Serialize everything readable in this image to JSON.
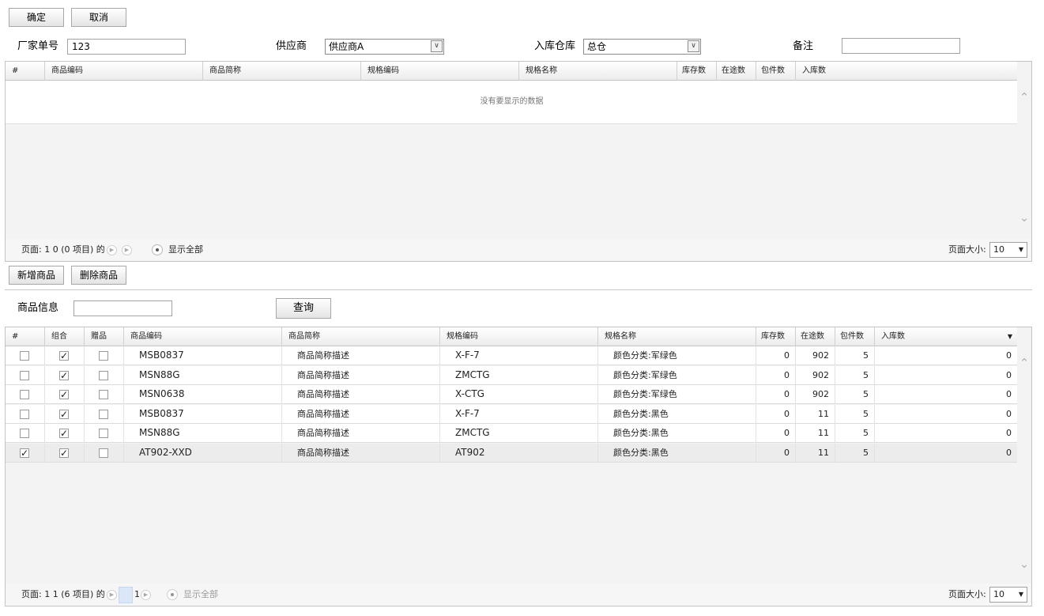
{
  "toolbar": {
    "confirm": "确定",
    "cancel": "取消"
  },
  "form": {
    "vendor_no_label": "厂家单号",
    "vendor_no_value": "123",
    "supplier_label": "供应商",
    "supplier_value": "供应商A",
    "warehouse_label": "入库仓库",
    "warehouse_value": "总仓",
    "remark_label": "备注",
    "remark_value": ""
  },
  "grid1": {
    "headers": [
      "#",
      "商品编码",
      "商品简称",
      "规格编码",
      "规格名称",
      "库存数",
      "在途数",
      "包件数",
      "入库数"
    ],
    "empty_text": "没有要显示的数据",
    "pager_text": "页面: 1 0 (0 项目) 的",
    "show_all": "显示全部",
    "page_size_label": "页面大小:",
    "page_size": "10"
  },
  "actions": {
    "add": "新增商品",
    "delete": "删除商品"
  },
  "search": {
    "label": "商品信息",
    "value": "",
    "button": "查询"
  },
  "grid2": {
    "headers": [
      "#",
      "组合",
      "赠品",
      "商品编码",
      "商品简称",
      "规格编码",
      "规格名称",
      "库存数",
      "在途数",
      "包件数",
      "入库数"
    ],
    "rows": [
      {
        "sel": false,
        "combo": true,
        "gift": false,
        "code": "MSB0837",
        "name": "商品简称描述",
        "sku": "X-F-7",
        "spec": "颜色分类:军绿色",
        "stock": "0",
        "transit": "902",
        "pack": "5",
        "inbound": "0"
      },
      {
        "sel": false,
        "combo": true,
        "gift": false,
        "code": "MSN88G",
        "name": "商品简称描述",
        "sku": "ZMCTG",
        "spec": "颜色分类:军绿色",
        "stock": "0",
        "transit": "902",
        "pack": "5",
        "inbound": "0"
      },
      {
        "sel": false,
        "combo": true,
        "gift": false,
        "code": "MSN0638",
        "name": "商品简称描述",
        "sku": "X-CTG",
        "spec": "颜色分类:军绿色",
        "stock": "0",
        "transit": "902",
        "pack": "5",
        "inbound": "0"
      },
      {
        "sel": false,
        "combo": true,
        "gift": false,
        "code": "MSB0837",
        "name": "商品简称描述",
        "sku": "X-F-7",
        "spec": "颜色分类:黑色",
        "stock": "0",
        "transit": "11",
        "pack": "5",
        "inbound": "0"
      },
      {
        "sel": false,
        "combo": true,
        "gift": false,
        "code": "MSN88G",
        "name": "商品简称描述",
        "sku": "ZMCTG",
        "spec": "颜色分类:黑色",
        "stock": "0",
        "transit": "11",
        "pack": "5",
        "inbound": "0"
      },
      {
        "sel": true,
        "combo": true,
        "gift": false,
        "code": "AT902-XXD",
        "name": "商品简称描述",
        "sku": "AT902",
        "spec": "颜色分类:黑色",
        "stock": "0",
        "transit": "11",
        "pack": "5",
        "inbound": "0"
      }
    ],
    "pager_text": "页面: 1 1 (6 项目) 的",
    "current_page": "1",
    "show_all": "显示全部",
    "page_size_label": "页面大小:",
    "page_size": "10"
  }
}
